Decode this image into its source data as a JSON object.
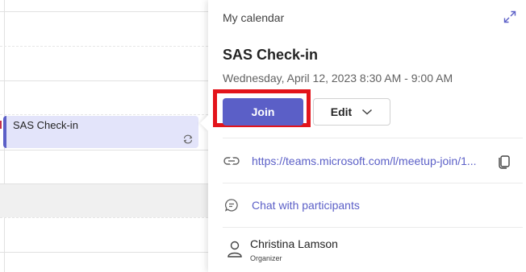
{
  "calendar_grid": {
    "event": {
      "title": "SAS Check-in",
      "icon": "recurring-icon"
    }
  },
  "panel": {
    "calendar_name": "My calendar",
    "meeting_title": "SAS Check-in",
    "meeting_time": "Wednesday, April 12, 2023 8:30 AM - 9:00 AM",
    "join_label": "Join",
    "edit_label": "Edit",
    "meeting_link": "https://teams.microsoft.com/l/meetup-join/1...",
    "chat_label": "Chat with participants",
    "organizer": {
      "name": "Christina Lamson",
      "role": "Organizer"
    }
  },
  "colors": {
    "accent": "#5b5fc7",
    "event_background": "#e3e4fa",
    "highlight_border": "#e3141b"
  }
}
